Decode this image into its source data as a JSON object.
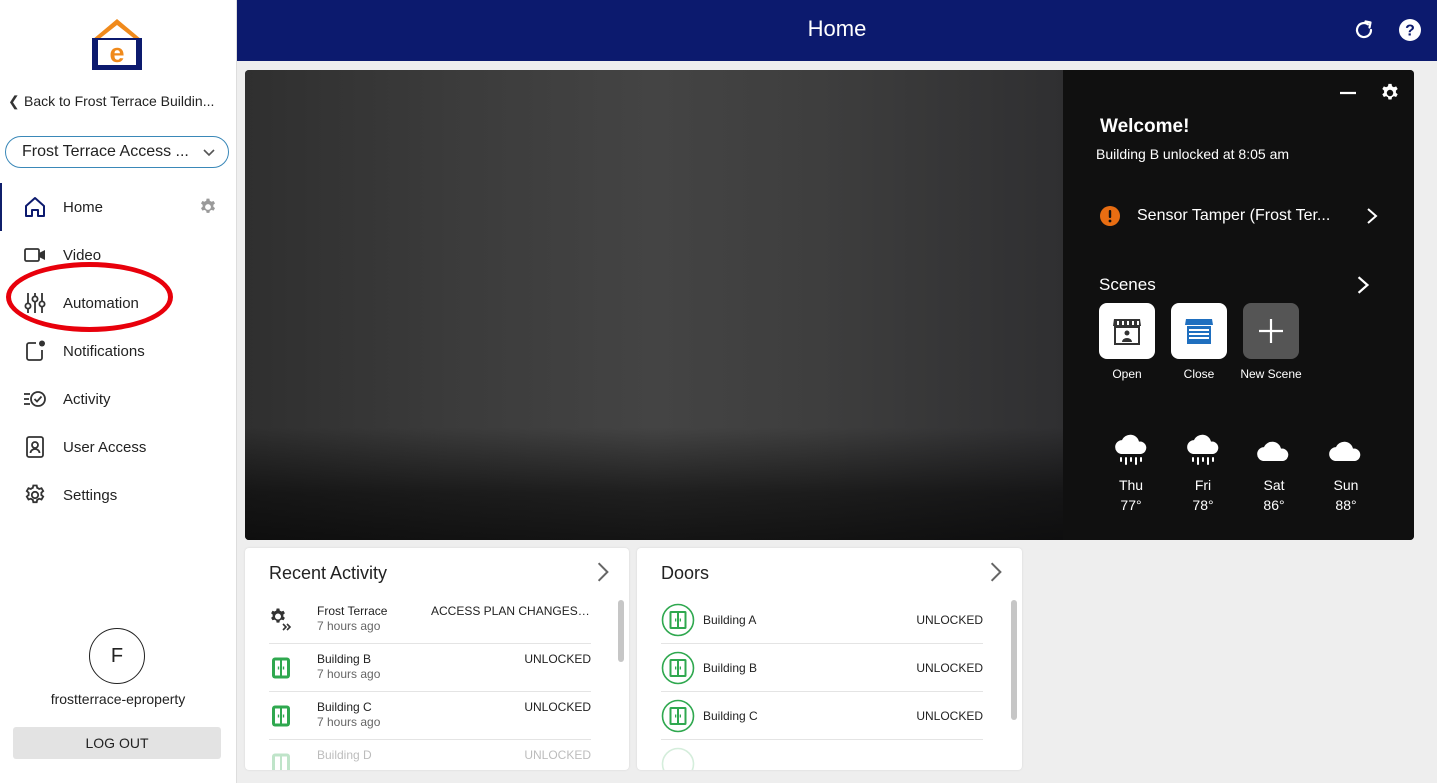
{
  "colors": {
    "navy": "#0c1a6e",
    "accent_orange": "#f08a1c",
    "alert_orange": "#e86d12",
    "door_green": "#2fa84f",
    "select_border": "#3a88b8",
    "highlight_red": "#e8000b"
  },
  "sidebar": {
    "back_label": "Back to Frost Terrace Buildin...",
    "site_select_value": "Frost Terrace Access ...",
    "nav": [
      {
        "label": "Home",
        "icon": "home-icon"
      },
      {
        "label": "Video",
        "icon": "video-camera-icon"
      },
      {
        "label": "Automation",
        "icon": "sliders-icon"
      },
      {
        "label": "Notifications",
        "icon": "bell-badge-icon"
      },
      {
        "label": "Activity",
        "icon": "activity-list-icon"
      },
      {
        "label": "User Access",
        "icon": "user-badge-icon"
      },
      {
        "label": "Settings",
        "icon": "gear-icon"
      }
    ],
    "avatar_initial": "F",
    "username": "frostterrace-eproperty",
    "logout_label": "LOG OUT"
  },
  "header": {
    "title": "Home"
  },
  "panel": {
    "welcome": "Welcome!",
    "status": "Building B unlocked at 8:05 am",
    "alert": "Sensor Tamper (Frost Ter...",
    "scenes_title": "Scenes",
    "scenes": [
      {
        "label": "Open"
      },
      {
        "label": "Close"
      },
      {
        "label": "New Scene"
      }
    ],
    "weather": [
      {
        "day": "Thu",
        "temp": "77°",
        "icon": "rain-cloud-icon"
      },
      {
        "day": "Fri",
        "temp": "78°",
        "icon": "rain-cloud-icon"
      },
      {
        "day": "Sat",
        "temp": "86°",
        "icon": "cloud-icon"
      },
      {
        "day": "Sun",
        "temp": "88°",
        "icon": "cloud-icon"
      }
    ]
  },
  "recent_activity": {
    "title": "Recent Activity",
    "rows": [
      {
        "name": "Frost Terrace",
        "time": "7 hours ago",
        "status": "ACCESS PLAN CHANGES ..."
      },
      {
        "name": "Building B",
        "time": "7 hours ago",
        "status": "UNLOCKED"
      },
      {
        "name": "Building C",
        "time": "7 hours ago",
        "status": "UNLOCKED"
      },
      {
        "name": "Building D",
        "time": "",
        "status": "UNLOCKED"
      }
    ]
  },
  "doors": {
    "title": "Doors",
    "rows": [
      {
        "name": "Building A",
        "status": "UNLOCKED"
      },
      {
        "name": "Building B",
        "status": "UNLOCKED"
      },
      {
        "name": "Building C",
        "status": "UNLOCKED"
      }
    ]
  }
}
